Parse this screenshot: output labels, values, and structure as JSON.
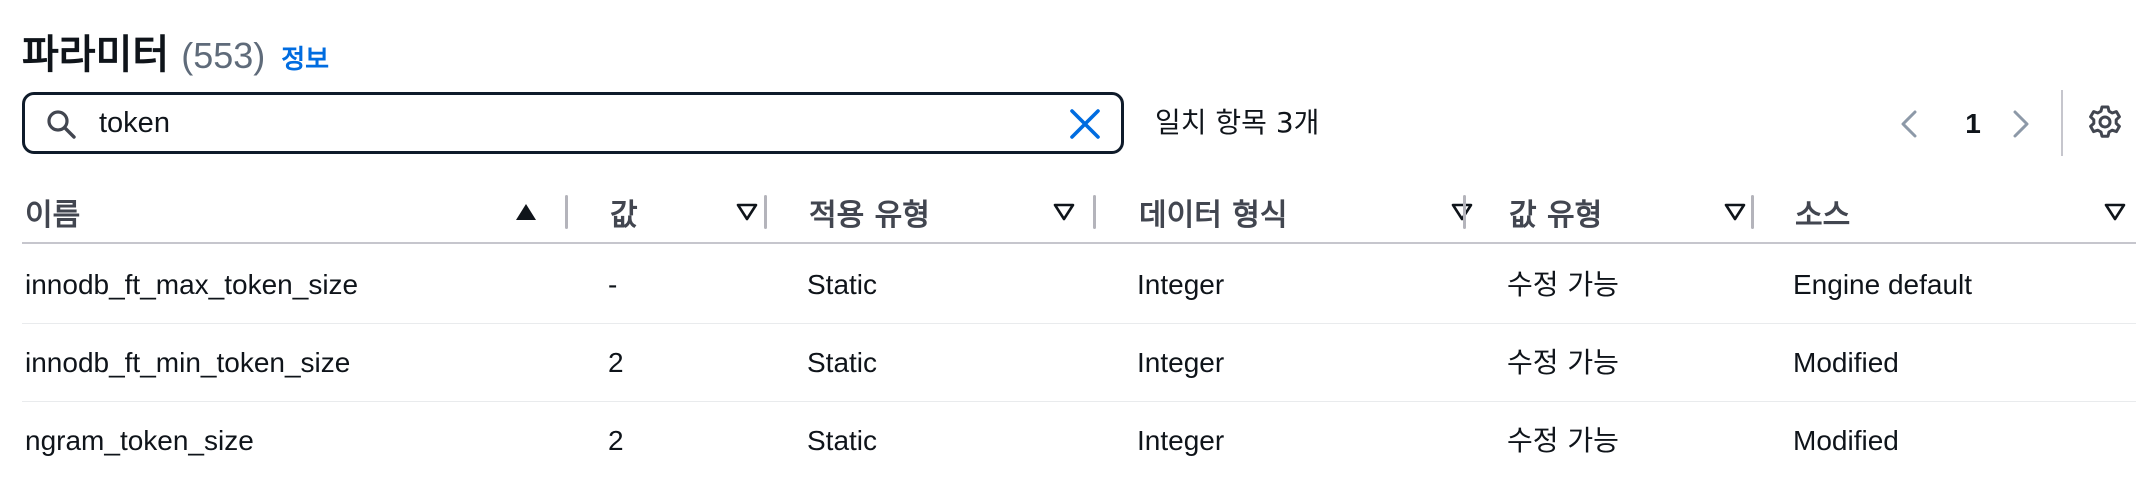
{
  "header": {
    "title": "파라미터",
    "count": "(553)",
    "info_link": "정보"
  },
  "search": {
    "value": "token",
    "placeholder": "",
    "match_count": "일치 항목 3개"
  },
  "pagination": {
    "current_page": "1"
  },
  "table": {
    "columns": [
      "이름",
      "값",
      "적용 유형",
      "데이터 형식",
      "값 유형",
      "소스"
    ],
    "rows": [
      [
        "innodb_ft_max_token_size",
        "-",
        "Static",
        "Integer",
        "수정 가능",
        "Engine default"
      ],
      [
        "innodb_ft_min_token_size",
        "2",
        "Static",
        "Integer",
        "수정 가능",
        "Modified"
      ],
      [
        "ngram_token_size",
        "2",
        "Static",
        "Integer",
        "수정 가능",
        "Modified"
      ]
    ]
  },
  "colors": {
    "accent": "#006ce0",
    "focus_border": "#0f1b2a",
    "text": "#0f141a",
    "muted": "#5f6b7a"
  },
  "icons": {
    "search": "search-icon",
    "clear": "close-icon",
    "prev": "chevron-left-icon",
    "next": "chevron-right-icon",
    "settings": "gear-icon",
    "sort_ascending": "caret-up-filled-icon",
    "sort_unsorted": "caret-down-outline-icon"
  }
}
